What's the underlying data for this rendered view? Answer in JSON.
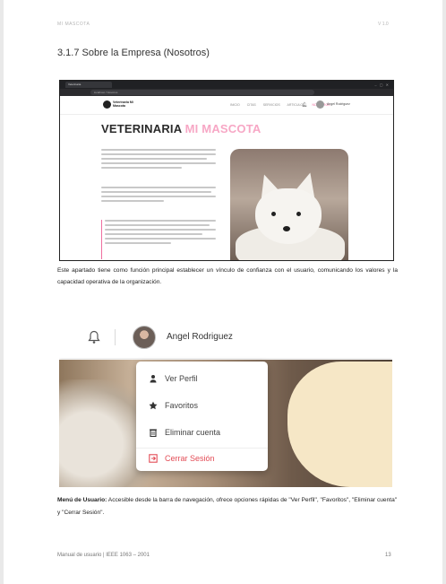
{
  "header": {
    "left": "MI MASCOTA",
    "right": "V 1.0"
  },
  "section_title": "3.1.7 Sobre la Empresa (Nosotros)",
  "screenshot1": {
    "tab": "Veterinaria",
    "url": "localhost / Nosotros",
    "logo": "Veterinaria Mi Mascota",
    "nav": [
      "INICIO",
      "CITAS",
      "SERVICIOS",
      "ARTICULOS",
      "NOSOTROS"
    ],
    "user_name": "Angel Rodriguez",
    "heading_dark": "VETERINARIA",
    "heading_pink": "MI MASCOTA",
    "brand_pink": "#f7a7c5"
  },
  "paragraph": "Este apartado tiene como función principal establecer un vínculo de confianza con el usuario, comunicando los valores y la capacidad operativa de la organización.",
  "screenshot2": {
    "user_name": "Angel Rodriguez",
    "menu": [
      {
        "label": "Ver Perfil",
        "icon": "person-icon"
      },
      {
        "label": "Favoritos",
        "icon": "star-icon"
      },
      {
        "label": "Eliminar cuenta",
        "icon": "trash-icon"
      },
      {
        "label": "Cerrar Sesión",
        "icon": "logout-icon"
      }
    ],
    "logout_color": "#e34c56"
  },
  "caption": {
    "bold": "Menú de Usuario:",
    "text": " Accesible desde la barra de navegación, ofrece opciones rápidas de \"Ver Perfil\", \"Favoritos\", \"Eliminar cuenta\" y \"Cerrar Sesión\"."
  },
  "footer": {
    "left": "Manual de usuario | IEEE 1063 – 2001",
    "page": "13"
  }
}
